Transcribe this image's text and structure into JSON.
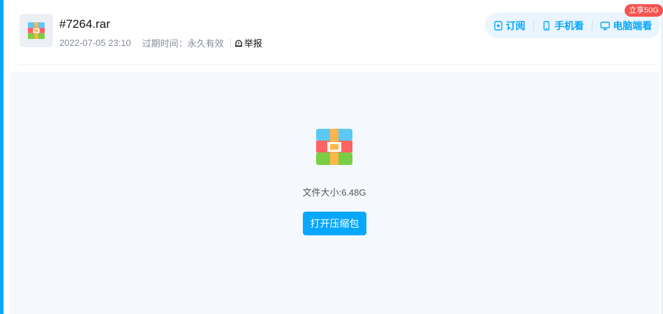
{
  "file": {
    "name": "#7264.rar",
    "date": "2022-07-05 23:10",
    "expire_label": "过期时间：",
    "expire_value": "永久有效",
    "report_label": "举报",
    "type_icon": "archive-icon"
  },
  "actions": {
    "subscribe_label": "订阅",
    "subscribe_icon": "bookmark-icon",
    "mobile_label": "手机看",
    "mobile_icon": "phone-icon",
    "desktop_label": "电脑端看",
    "desktop_icon": "monitor-icon",
    "promo_badge": "立享50G"
  },
  "main": {
    "size_label": "文件大小:",
    "size_value": "6.48G",
    "open_button": "打开压缩包"
  },
  "colors": {
    "accent": "#06a7ff",
    "promo": "#f5534f",
    "panel_bg": "#f5f8fc"
  }
}
